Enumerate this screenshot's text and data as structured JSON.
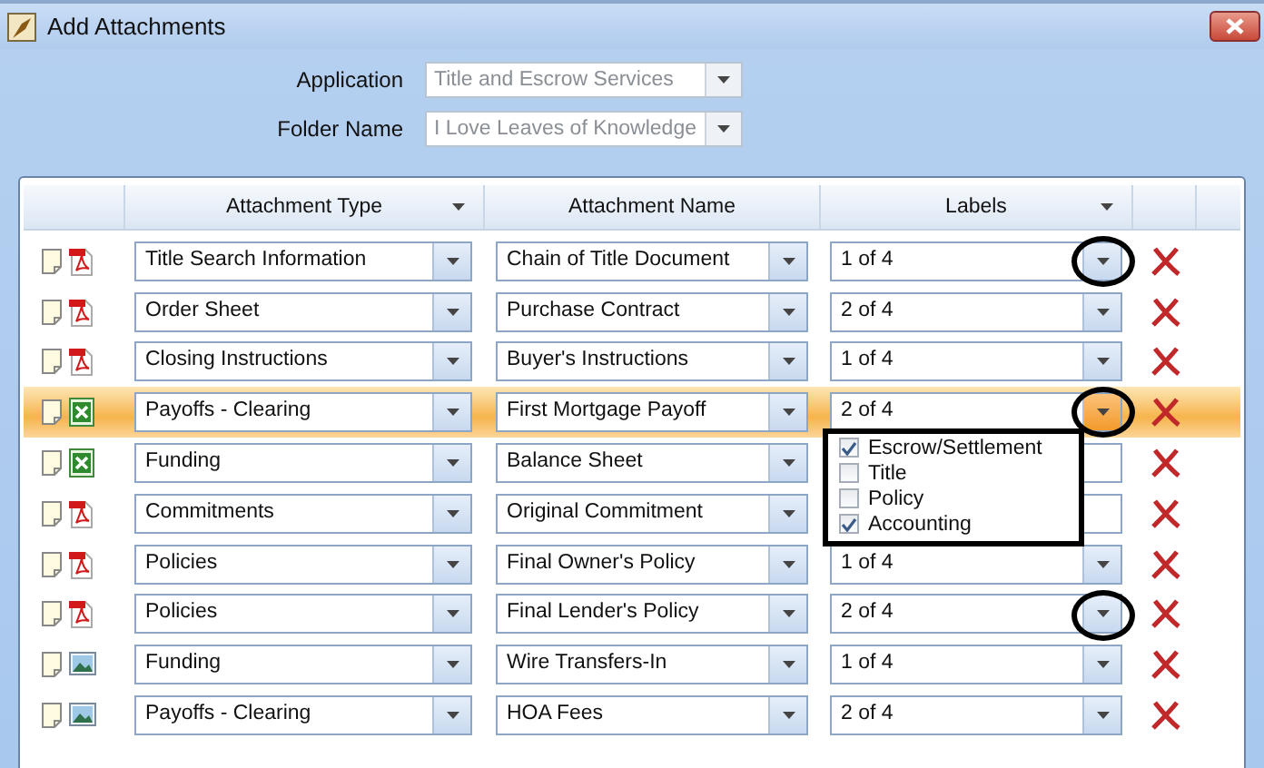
{
  "window": {
    "title": "Add Attachments"
  },
  "form": [
    {
      "label": "Application",
      "value": "Title and Escrow Services",
      "disabled": true
    },
    {
      "label": "Folder Name",
      "value": "I Love Leaves of Knowledge",
      "disabled": true
    }
  ],
  "table": {
    "columns": [
      {
        "label": "Attachment Type",
        "menu": true
      },
      {
        "label": "Attachment Name",
        "menu": false
      },
      {
        "label": "Labels",
        "menu": true
      }
    ],
    "rows": [
      {
        "kind": "pdf",
        "type": "Title Search Information",
        "name": "Chain of Title Document",
        "labels": "1 of 4",
        "selected": false,
        "circled": true
      },
      {
        "kind": "pdf",
        "type": "Order Sheet",
        "name": "Purchase Contract",
        "labels": "2 of 4",
        "selected": false,
        "circled": false
      },
      {
        "kind": "pdf",
        "type": "Closing Instructions",
        "name": "Buyer's Instructions",
        "labels": "1 of 4",
        "selected": false,
        "circled": false
      },
      {
        "kind": "excel",
        "type": "Payoffs - Clearing",
        "name": "First Mortgage Payoff",
        "labels": "2 of 4",
        "selected": true,
        "circled": true,
        "label_options": [
          {
            "label": "Escrow/Settlement",
            "checked": true
          },
          {
            "label": "Title",
            "checked": false
          },
          {
            "label": "Policy",
            "checked": false
          },
          {
            "label": "Accounting",
            "checked": true
          }
        ]
      },
      {
        "kind": "excel",
        "type": "Funding",
        "name": "Balance Sheet",
        "labels_button": false,
        "selected": false,
        "circled": false
      },
      {
        "kind": "pdf",
        "type": "Commitments",
        "name": "Original Commitment",
        "labels_button": false,
        "selected": false,
        "circled": false
      },
      {
        "kind": "pdf",
        "type": "Policies",
        "name": "Final Owner's Policy",
        "labels": "1 of 4",
        "selected": false,
        "circled": false
      },
      {
        "kind": "pdf",
        "type": "Policies",
        "name": "Final Lender's Policy",
        "labels": "2 of 4",
        "selected": false,
        "circled": true
      },
      {
        "kind": "image",
        "type": "Funding",
        "name": "Wire Transfers-In",
        "labels": "1 of 4",
        "selected": false,
        "circled": false
      },
      {
        "kind": "image",
        "type": "Payoffs - Clearing",
        "name": "HOA Fees",
        "labels": "2 of 4",
        "selected": false,
        "circled": false
      }
    ]
  }
}
